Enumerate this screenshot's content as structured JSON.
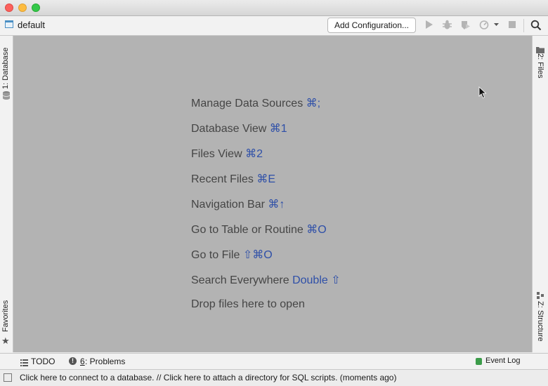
{
  "toolbar": {
    "project_name": "default",
    "config_button": "Add Configuration..."
  },
  "tool_windows": {
    "left_top": "1: Database",
    "left_bottom": "Favorites",
    "right_top": "2: Files",
    "right_bottom": "Z: Structure"
  },
  "hints": [
    {
      "label": "Manage Data Sources",
      "shortcut": "⌘;"
    },
    {
      "label": "Database View",
      "shortcut": "⌘1"
    },
    {
      "label": "Files View",
      "shortcut": "⌘2"
    },
    {
      "label": "Recent Files",
      "shortcut": "⌘E"
    },
    {
      "label": "Navigation Bar",
      "shortcut": "⌘↑"
    },
    {
      "label": "Go to Table or Routine",
      "shortcut": "⌘O"
    },
    {
      "label": "Go to File",
      "shortcut": "⇧⌘O"
    },
    {
      "label": "Search Everywhere",
      "shortcut": "Double ⇧"
    },
    {
      "label": "Drop files here to open",
      "shortcut": ""
    }
  ],
  "bottom_tabs": {
    "todo": "TODO",
    "problems_num": "6",
    "problems_label": ": Problems",
    "event_log": "Event Log"
  },
  "status": {
    "message": "Click here to connect to a database. // Click here to attach a directory for SQL scripts. (moments ago)"
  },
  "colors": {
    "editor_bg": "#b3b3b3",
    "shortcut": "#2e4fa8"
  }
}
